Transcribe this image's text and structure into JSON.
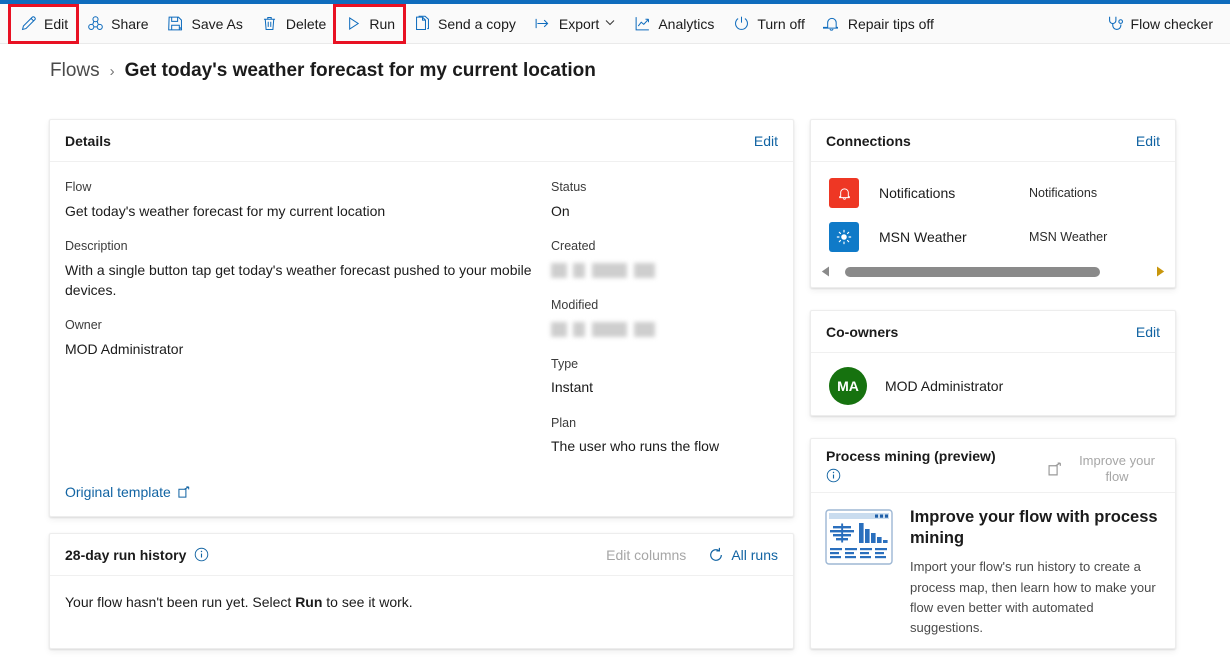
{
  "theme": {
    "accent": "#0f6cbd",
    "link": "#1264a3",
    "highlight": "#e81123",
    "notifications_brand": "#ee3724",
    "msn_weather_brand": "#0f7ac8",
    "avatar_green": "#16720f"
  },
  "command_bar": {
    "left_items": [
      {
        "label": "Edit",
        "icon": "pencil-icon",
        "highlighted": true
      },
      {
        "label": "Share",
        "icon": "share-icon",
        "highlighted": false
      },
      {
        "label": "Save As",
        "icon": "save-as-icon",
        "highlighted": false
      },
      {
        "label": "Delete",
        "icon": "trash-icon",
        "highlighted": false
      },
      {
        "label": "Run",
        "icon": "play-icon",
        "highlighted": true
      },
      {
        "label": "Send a copy",
        "icon": "copy-icon",
        "highlighted": false
      },
      {
        "label": "Export",
        "icon": "export-icon",
        "highlighted": false,
        "chevron": "⌄"
      },
      {
        "label": "Analytics",
        "icon": "analytics-icon",
        "highlighted": false
      },
      {
        "label": "Turn off",
        "icon": "power-icon",
        "highlighted": false
      },
      {
        "label": "Repair tips off",
        "icon": "bell-icon",
        "highlighted": false
      }
    ],
    "right_items": [
      {
        "label": "Flow checker",
        "icon": "stethoscope-icon"
      }
    ]
  },
  "breadcrumb": {
    "root": "Flows",
    "separator": "›",
    "current": "Get today's weather forecast for my current location"
  },
  "details": {
    "title": "Details",
    "edit_label": "Edit",
    "left_fields": [
      {
        "label": "Flow",
        "value": "Get today's weather forecast for my current location",
        "redacted": false
      },
      {
        "label": "Description",
        "value": "With a single button tap get today's weather forecast pushed to your mobile devices.",
        "redacted": false
      },
      {
        "label": "Owner",
        "value": "MOD Administrator",
        "redacted": false
      }
    ],
    "right_fields": [
      {
        "label": "Status",
        "value": "On",
        "redacted": false
      },
      {
        "label": "Created",
        "value": "",
        "redacted": true
      },
      {
        "label": "Modified",
        "value": "",
        "redacted": true
      },
      {
        "label": "Type",
        "value": "Instant",
        "redacted": false
      },
      {
        "label": "Plan",
        "value": "The user who runs the flow",
        "redacted": false
      }
    ],
    "template_link": "Original template",
    "template_link_icon": "external-link-icon"
  },
  "run_history": {
    "title": "28-day run history",
    "info_icon": "info-icon",
    "edit_columns_label": "Edit columns",
    "all_runs_label": "All runs",
    "all_runs_icon": "refresh-icon",
    "empty_text_before": "Your flow hasn't been run yet. Select ",
    "empty_text_bold": "Run",
    "empty_text_after": " to see it work."
  },
  "connections": {
    "title": "Connections",
    "edit_label": "Edit",
    "rows": [
      {
        "name": "Notifications",
        "account": "Notifications",
        "icon": "bell-icon",
        "color": "#ee3724"
      },
      {
        "name": "MSN Weather",
        "account": "MSN Weather",
        "icon": "sun-icon",
        "color": "#0f7ac8"
      }
    ],
    "scroll_left_icon": "caret-left-icon",
    "scroll_right_icon": "caret-right-icon"
  },
  "co_owners": {
    "title": "Co-owners",
    "edit_label": "Edit",
    "people": [
      {
        "initials": "MA",
        "name": "MOD Administrator"
      }
    ]
  },
  "process_mining": {
    "title": "Process mining (preview)",
    "info_icon": "info-icon",
    "header_link": "Improve your flow",
    "header_link_icon": "external-link-icon",
    "thumbnail_icon": "process-map-chart-icon",
    "heading": "Improve your flow with process mining",
    "description": "Import your flow's run history to create a process map, then learn how to make your flow even better with automated suggestions."
  }
}
